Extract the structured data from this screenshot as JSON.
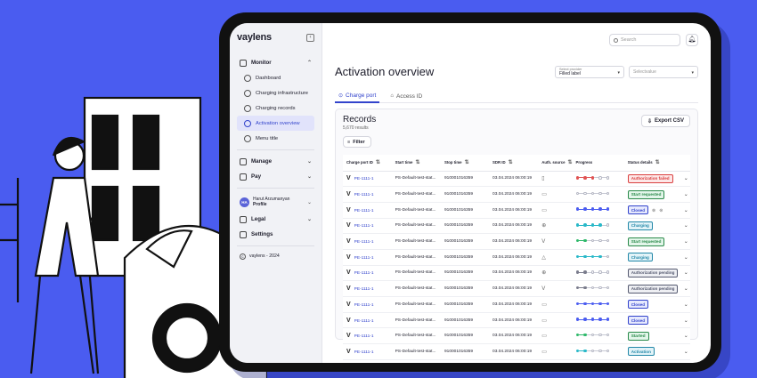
{
  "colors": {
    "background": "#4a5cf0",
    "accent": "#3344cc",
    "progress_red": "#e05252",
    "progress_blue": "#4a5cf0",
    "progress_cyan": "#28b8c8",
    "progress_gray": "#7a7c8c",
    "progress_green": "#2eb86a"
  },
  "sidebar": {
    "brand": "vaylens",
    "monitor": {
      "label": "Monitor",
      "icon": "monitor-icon"
    },
    "items": [
      {
        "label": "Dashboard",
        "icon": "dashboard-icon"
      },
      {
        "label": "Charging infrastructure",
        "icon": "charging-infrastructure-icon"
      },
      {
        "label": "Charging records",
        "icon": "charging-records-icon"
      },
      {
        "label": "Activation overview",
        "icon": "activation-icon",
        "active": true
      },
      {
        "label": "Menu title",
        "icon": "menu-icon"
      }
    ],
    "manage": "Manage",
    "pay": "Pay",
    "user": {
      "initials": "HA",
      "name": "Harut Arzumanyan",
      "sub": "Profile"
    },
    "legal": "Legal",
    "settings": "Settings",
    "copyright": "vaylens - 2024"
  },
  "topbar": {
    "search_placeholder": "Search"
  },
  "page": {
    "title": "Activation overview",
    "provider_label": "Select provider",
    "provider_value": "Filled label",
    "selection_placeholder": "Selectvalue"
  },
  "tabs": [
    {
      "label": "Charge port",
      "icon": "charge-port-icon",
      "active": true
    },
    {
      "label": "Access ID",
      "icon": "access-id-icon",
      "active": false
    }
  ],
  "records": {
    "title": "Records",
    "count": "5,670 results",
    "export_label": "Export CSV",
    "filter_label": "Filter"
  },
  "table": {
    "headers": [
      "Charge port ID",
      "Start time",
      "Stop time",
      "SDR ID",
      "Auth. source",
      "Progress",
      "Status details"
    ],
    "rows": [
      {
        "cp": "PE-1111-1",
        "start": "PS-Default-test-stat...",
        "stop": "910001016359",
        "sdr": "03.04.2024 06:00:19",
        "auth": "card-icon",
        "progress": [
          3,
          "red"
        ],
        "status": "Authorization failed",
        "scolor": "#d94040",
        "sbg": "#fde7e7",
        "actions": false
      },
      {
        "cp": "PE-1111-1",
        "start": "PS-Default-test-stat...",
        "stop": "910001016359",
        "sdr": "03.04.2024 06:00:19",
        "auth": "monitor-icon",
        "progress": [
          0,
          "gray"
        ],
        "status": "Start requested",
        "scolor": "#2a8a4a",
        "sbg": "#e3f6ea",
        "actions": false
      },
      {
        "cp": "PE-1111-1",
        "start": "PS-Default-test-stat...",
        "stop": "910001016359",
        "sdr": "03.04.2024 06:00:19",
        "auth": "monitor-icon",
        "progress": [
          5,
          "blue"
        ],
        "status": "Closed",
        "scolor": "#3344cc",
        "sbg": "#e6e9fd",
        "actions": true
      },
      {
        "cp": "PE-1111-1",
        "start": "PS-Default-test-stat...",
        "stop": "910001016359",
        "sdr": "03.04.2024 06:00:19",
        "auth": "globe-icon",
        "progress": [
          4,
          "cyan"
        ],
        "status": "Charging",
        "scolor": "#2388a8",
        "sbg": "#e2f3f8",
        "actions": false
      },
      {
        "cp": "PE-1111-1",
        "start": "PS-Default-test-stat...",
        "stop": "910001016359",
        "sdr": "03.04.2024 06:00:19",
        "auth": "vaylens-icon",
        "progress": [
          2,
          "green"
        ],
        "status": "Start requested",
        "scolor": "#2a8a4a",
        "sbg": "#e3f6ea",
        "actions": false
      },
      {
        "cp": "PE-1111-1",
        "start": "PS-Default-test-stat...",
        "stop": "910001016359",
        "sdr": "03.04.2024 06:00:19",
        "auth": "warning-icon",
        "progress": [
          4,
          "cyan"
        ],
        "status": "Charging",
        "scolor": "#2388a8",
        "sbg": "#e2f3f8",
        "actions": false
      },
      {
        "cp": "PE-1111-1",
        "start": "PS-Default-test-stat...",
        "stop": "910001016359",
        "sdr": "03.04.2024 06:00:19",
        "auth": "globe-icon",
        "progress": [
          2,
          "gray"
        ],
        "status": "Authorization pending",
        "scolor": "#555a70",
        "sbg": "#eeeff3",
        "actions": false
      },
      {
        "cp": "PE-1111-1",
        "start": "PS-Default-test-stat...",
        "stop": "910001016359",
        "sdr": "03.04.2024 06:00:19",
        "auth": "vaylens-icon",
        "progress": [
          2,
          "gray"
        ],
        "status": "Authorization pending",
        "scolor": "#555a70",
        "sbg": "#eeeff3",
        "actions": false
      },
      {
        "cp": "PE-1111-1",
        "start": "PS-Default-test-stat...",
        "stop": "910001016359",
        "sdr": "03.04.2024 06:00:19",
        "auth": "monitor-icon",
        "progress": [
          5,
          "blue"
        ],
        "status": "Closed",
        "scolor": "#3344cc",
        "sbg": "#e6e9fd",
        "actions": false
      },
      {
        "cp": "PE-1111-1",
        "start": "PS-Default-test-stat...",
        "stop": "910001016359",
        "sdr": "03.04.2024 06:00:19",
        "auth": "monitor-icon",
        "progress": [
          5,
          "blue"
        ],
        "status": "Closed",
        "scolor": "#3344cc",
        "sbg": "#e6e9fd",
        "actions": false
      },
      {
        "cp": "PE-1111-1",
        "start": "PS-Default-test-stat...",
        "stop": "910001016359",
        "sdr": "03.04.2024 06:00:19",
        "auth": "monitor-icon",
        "progress": [
          2,
          "green"
        ],
        "status": "Started",
        "scolor": "#2a8a4a",
        "sbg": "#e3f6ea",
        "actions": false
      },
      {
        "cp": "PE-1111-1",
        "start": "PS-Default-test-stat...",
        "stop": "910001016359",
        "sdr": "03.04.2024 06:00:19",
        "auth": "monitor-icon",
        "progress": [
          2,
          "cyan"
        ],
        "status": "Activation",
        "scolor": "#2388a8",
        "sbg": "#e2f3f8",
        "actions": false
      }
    ]
  }
}
